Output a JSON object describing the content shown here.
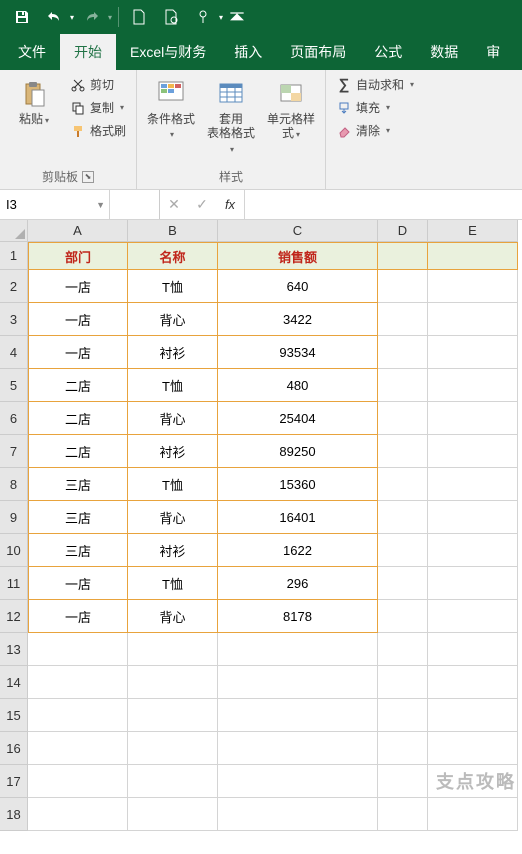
{
  "qat": {
    "save": "save-icon",
    "undo": "undo-icon",
    "redo": "redo-icon",
    "new": "new-file-icon",
    "newq": "new-search-icon",
    "touch": "touch-mode-icon"
  },
  "tabs": {
    "file": "文件",
    "home": "开始",
    "excelfin": "Excel与财务",
    "insert": "插入",
    "layout": "页面布局",
    "formulas": "公式",
    "data": "数据",
    "review": "审"
  },
  "ribbon": {
    "clipboard": {
      "paste": "粘贴",
      "cut": "剪切",
      "copy": "复制",
      "painter": "格式刷",
      "label": "剪贴板"
    },
    "styles": {
      "cond": "条件格式",
      "table": "套用\n表格格式",
      "cell": "单元格样式",
      "label": "样式"
    },
    "editing": {
      "sum": "自动求和",
      "fill": "填充",
      "clear": "清除"
    }
  },
  "namebox": "I3",
  "formula": "",
  "cols": [
    "A",
    "B",
    "C",
    "D",
    "E"
  ],
  "rows": [
    "1",
    "2",
    "3",
    "4",
    "5",
    "6",
    "7",
    "8",
    "9",
    "10",
    "11",
    "12",
    "13",
    "14",
    "15",
    "16",
    "17",
    "18"
  ],
  "headers": {
    "a": "部门",
    "b": "名称",
    "c": "销售额"
  },
  "data": [
    {
      "a": "一店",
      "b": "T恤",
      "c": "640"
    },
    {
      "a": "一店",
      "b": "背心",
      "c": "3422"
    },
    {
      "a": "一店",
      "b": "衬衫",
      "c": "93534"
    },
    {
      "a": "二店",
      "b": "T恤",
      "c": "480"
    },
    {
      "a": "二店",
      "b": "背心",
      "c": "25404"
    },
    {
      "a": "二店",
      "b": "衬衫",
      "c": "89250"
    },
    {
      "a": "三店",
      "b": "T恤",
      "c": "15360"
    },
    {
      "a": "三店",
      "b": "背心",
      "c": "16401"
    },
    {
      "a": "三店",
      "b": "衬衫",
      "c": "1622"
    },
    {
      "a": "一店",
      "b": "T恤",
      "c": "296"
    },
    {
      "a": "一店",
      "b": "背心",
      "c": "8178"
    }
  ],
  "watermark": "支点攻略"
}
